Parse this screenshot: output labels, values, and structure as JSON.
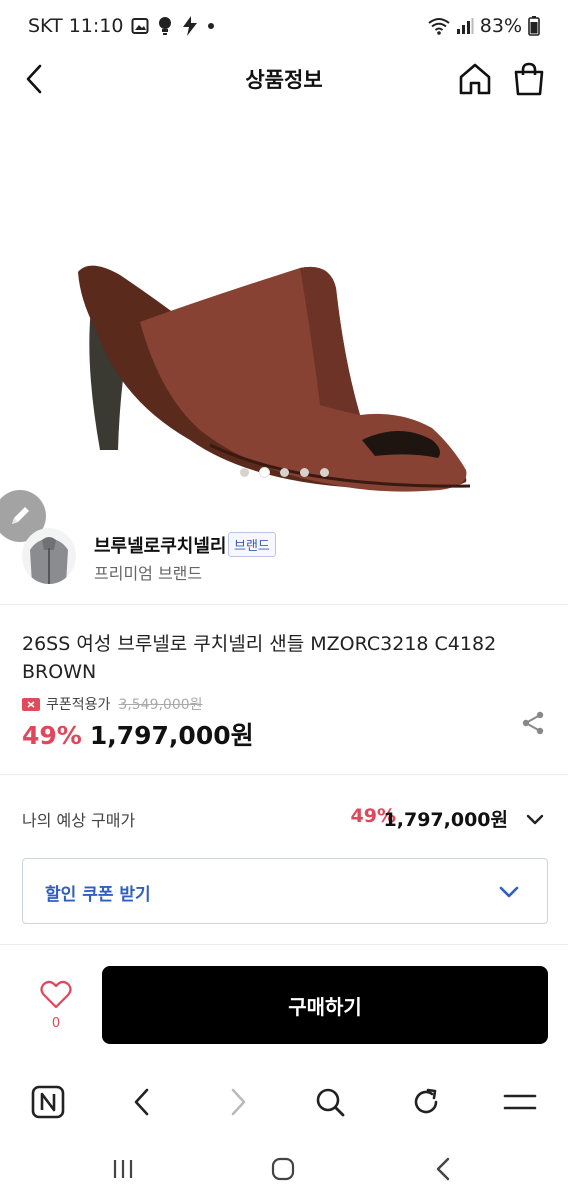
{
  "status_bar": {
    "carrier_time": "SKT 11:10",
    "battery": "83%",
    "icons": [
      "gallery-icon",
      "bulb-icon",
      "bolt-icon",
      "dot-icon",
      "wifi-icon",
      "signal-icon",
      "battery-icon"
    ]
  },
  "nav": {
    "title": "상품정보",
    "icons": [
      "back-icon",
      "home-icon",
      "shopping-bag-icon"
    ]
  },
  "product": {
    "image_alt_icon": "sandal-image",
    "carousel": {
      "count": 5,
      "active_index": 1
    },
    "title": "26SS 여성 브루넬로 쿠치넬리 샌들 MZORC3218 C4182 BROWN",
    "coupon_label": "쿠폰적용가",
    "original_price": "3,549,000원",
    "discount_rate": "49%",
    "sale_price": "1,797,000원"
  },
  "brand": {
    "name": "브루넬로쿠치넬리",
    "badge": "브랜드",
    "subtitle": "프리미엄 브랜드"
  },
  "expected": {
    "label": "나의 예상 구매가",
    "rate": "49%",
    "price": "1,797,000원"
  },
  "coupon_box": {
    "label": "할인 쿠폰 받기"
  },
  "actions": {
    "like_count": "0",
    "buy_label": "구매하기"
  },
  "browser_bar": {
    "icons": [
      "n-home-icon",
      "back-arrow-icon",
      "forward-arrow-icon",
      "search-icon",
      "refresh-icon",
      "menu-icon"
    ]
  },
  "system_nav": {
    "icons": [
      "recents-icon",
      "home-circle-icon",
      "system-back-icon"
    ]
  },
  "colors": {
    "accent_red": "#e0475a",
    "link_blue": "#2f5fbf",
    "button_black": "#000000"
  }
}
